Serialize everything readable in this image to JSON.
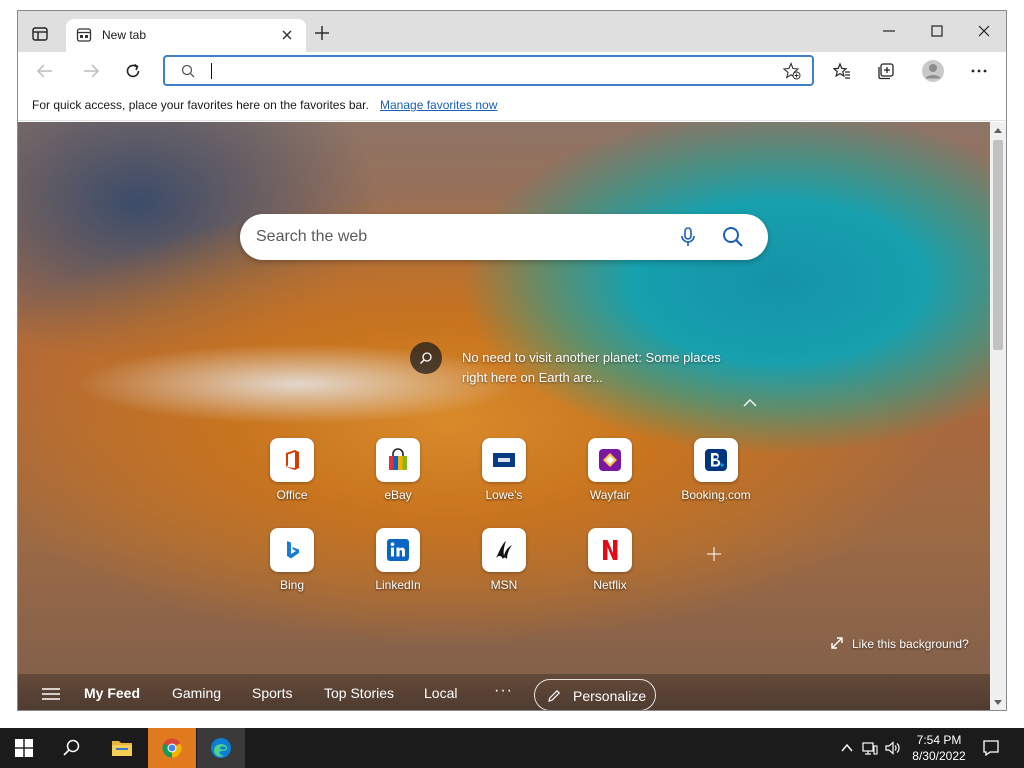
{
  "browser": {
    "tab_title": "New tab",
    "address_value": "",
    "favorites_bar": {
      "message": "For quick access, place your favorites here on the favorites bar.",
      "link": "Manage favorites now"
    }
  },
  "newtab": {
    "search_placeholder": "Search the web",
    "caption": "No need to visit another planet: Some places right here on Earth are...",
    "like_background": "Like this background?",
    "tiles": [
      {
        "label": "Office"
      },
      {
        "label": "eBay"
      },
      {
        "label": "Lowe's"
      },
      {
        "label": "Wayfair"
      },
      {
        "label": "Booking.com"
      },
      {
        "label": "Bing"
      },
      {
        "label": "LinkedIn"
      },
      {
        "label": "MSN"
      },
      {
        "label": "Netflix"
      }
    ],
    "feed_tabs": [
      "My Feed",
      "Gaming",
      "Sports",
      "Top Stories",
      "Local"
    ],
    "feed_more": "···",
    "personalize": "Personalize"
  },
  "taskbar": {
    "time": "7:54 PM",
    "date": "8/30/2022"
  },
  "colors": {
    "accent": "#3f7fc6",
    "link": "#1a5fb4",
    "taskbar": "#1b1b1b"
  },
  "icons": {
    "office_icon": "office-icon",
    "ebay_icon": "ebay-icon",
    "lowes_icon": "lowes-icon",
    "wayfair_icon": "wayfair-icon",
    "booking_icon": "booking-icon",
    "bing_icon": "bing-icon",
    "linkedin_icon": "linkedin-icon",
    "msn_icon": "msn-icon",
    "netflix_icon": "netflix-icon"
  }
}
